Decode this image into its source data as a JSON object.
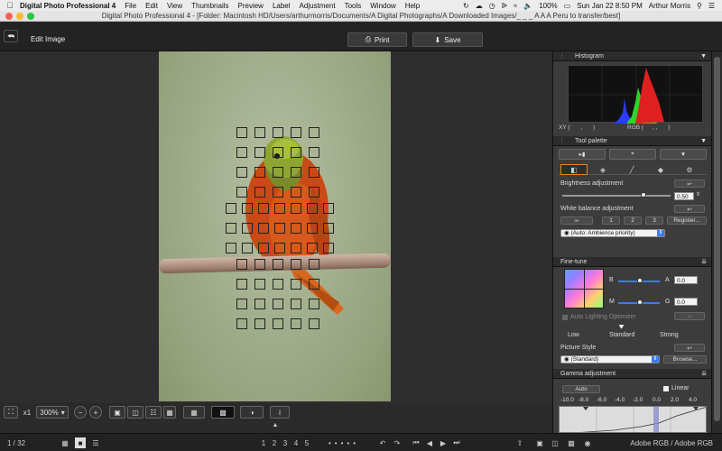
{
  "menubar": {
    "app_name": "Digital Photo Professional 4",
    "items": [
      "File",
      "Edit",
      "View",
      "Thumbnails",
      "Preview",
      "Label",
      "Adjustment",
      "Tools",
      "Window",
      "Help"
    ],
    "battery": "100%",
    "datetime": "Sun Jan 22  8:50 PM",
    "user": "Arthur Morris"
  },
  "window": {
    "title": "Digital Photo Professional 4 - [Folder: Macintosh HD/Users/arthurmorris/Documents/A Digital Photographs/A Downloaded Images/_ _ _ A A A Peru to transfer/best]"
  },
  "toolbar": {
    "edit_title": "Edit Image",
    "print_label": "Print",
    "save_label": "Save"
  },
  "canvasbar": {
    "zoom_x1": "x1",
    "zoom_level": "300%"
  },
  "statusbar": {
    "page_count": "1 / 32",
    "rating_labels": [
      "1",
      "2",
      "3",
      "4",
      "5"
    ],
    "color_space": "Adobe RGB / Adobe RGB"
  },
  "histogram": {
    "header": "Histogram",
    "xy_label": "XY (",
    "xy_value": ",",
    "xy_close": ")",
    "rgb_label": "RGB (",
    "rgb_value": ",         ,",
    "rgb_close": ")"
  },
  "tool_palette": {
    "header": "Tool palette",
    "brightness_label": "Brightness adjustment",
    "brightness_value": "0.50",
    "brightness_level": 0.75,
    "wb_label": "White balance adjustment",
    "wb_buttons": [
      "1",
      "2",
      "3"
    ],
    "wb_register": "Register...",
    "wb_select": "(Auto: Ambience priority)"
  },
  "fine_tune": {
    "header": "Fine-tune",
    "b_label": "B",
    "a_label": "A",
    "a_value": "0.0",
    "m_label": "M",
    "g_label": "G",
    "g_value": "0.0",
    "alo_label": "Auto Lighting Optimizer",
    "low_label": "Low",
    "standard_label": "Standard",
    "strong_label": "Strong",
    "picture_style_label": "Picture Style",
    "picture_style_select": "(Standard)",
    "browse_label": "Browse..."
  },
  "gamma": {
    "header": "Gamma adjustment",
    "auto_label": "Auto",
    "linear_label": "Linear",
    "scale": [
      "-10.0",
      "-8.0",
      "-6.0",
      "-4.0",
      "-2.0",
      "0.0",
      "2.0",
      "4.0"
    ]
  },
  "colors": {
    "accent": "#3b7cf0",
    "bird_orange": "#c94a14",
    "bird_green": "#8fa532"
  }
}
